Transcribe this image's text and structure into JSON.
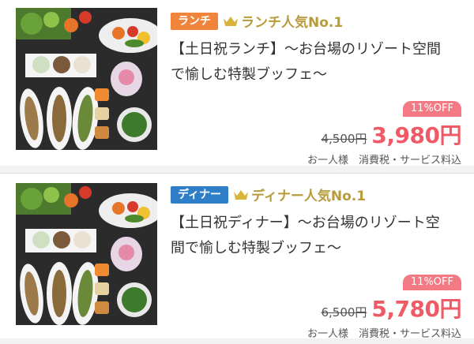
{
  "offers": [
    {
      "badge": "ランチ",
      "badge_color": "#f0843a",
      "rank_label": "ランチ人気No.1",
      "title": "【土日祝ランチ】〜お台場のリゾート空間で愉しむ特製ブッフェ〜",
      "discount": "11%OFF",
      "original_price": "4,500円",
      "price": "3,980円",
      "price_note": "お一人様　消費税・サービス料込"
    },
    {
      "badge": "ディナー",
      "badge_color": "#2f7ec8",
      "rank_label": "ディナー人気No.1",
      "title": "【土日祝ディナー】〜お台場のリゾート空間で愉しむ特製ブッフェ〜",
      "discount": "11%OFF",
      "original_price": "6,500円",
      "price": "5,780円",
      "price_note": "お一人様　消費税・サービス料込"
    }
  ],
  "icons": {
    "rank": "crown-icon",
    "photo": "buffet-food-photo"
  },
  "colors": {
    "rank_gold": "#b79b3c",
    "price_red": "#f05a66",
    "discount_pink": "#f37a84"
  }
}
